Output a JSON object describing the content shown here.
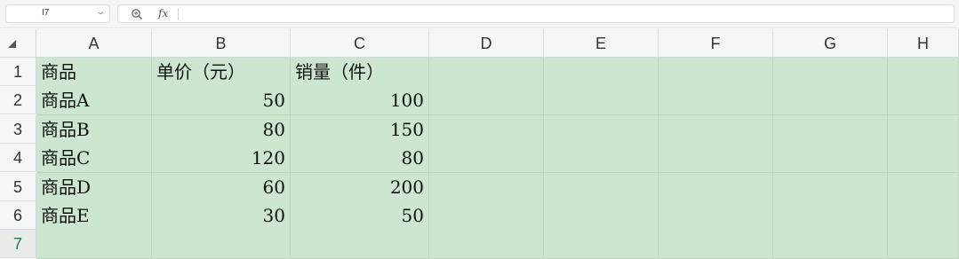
{
  "name_box": {
    "value": "I7"
  },
  "formula_bar": {
    "fx_label": "fx",
    "formula": ""
  },
  "columns": [
    "A",
    "B",
    "C",
    "D",
    "E",
    "F",
    "G",
    "H"
  ],
  "rows": [
    "1",
    "2",
    "3",
    "4",
    "5",
    "6",
    "7"
  ],
  "active_row": "7",
  "cells": [
    [
      "商品",
      "单价（元）",
      "销量（件）",
      "",
      "",
      "",
      "",
      ""
    ],
    [
      "商品A",
      "50",
      "100",
      "",
      "",
      "",
      "",
      ""
    ],
    [
      "商品B",
      "80",
      "150",
      "",
      "",
      "",
      "",
      ""
    ],
    [
      "商品C",
      "120",
      "80",
      "",
      "",
      "",
      "",
      ""
    ],
    [
      "商品D",
      "60",
      "200",
      "",
      "",
      "",
      "",
      ""
    ],
    [
      "商品E",
      "30",
      "50",
      "",
      "",
      "",
      "",
      ""
    ],
    [
      "",
      "",
      "",
      "",
      "",
      "",
      "",
      ""
    ]
  ],
  "colors": {
    "cell_fill": "#cde6cf",
    "header_bg": "#f5f6f7",
    "active_row_text": "#1e7b47"
  }
}
